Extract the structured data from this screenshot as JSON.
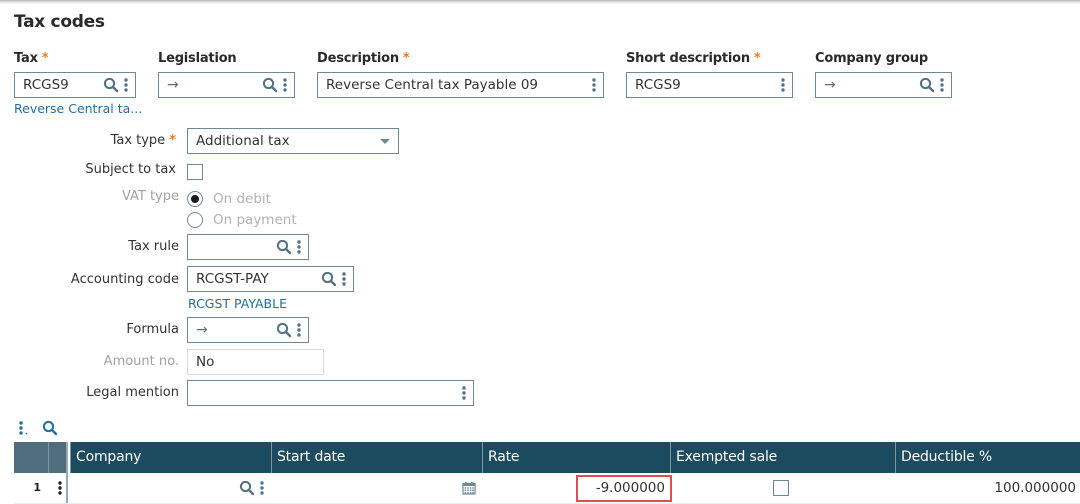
{
  "page": {
    "title": "Tax codes"
  },
  "header_fields": {
    "tax": {
      "label": "Tax",
      "required": true,
      "value": "RCGS9",
      "link": "Reverse Central ta..."
    },
    "legislation": {
      "label": "Legislation",
      "value": "→"
    },
    "description": {
      "label": "Description",
      "required": true,
      "value": "Reverse Central tax Payable 09"
    },
    "short_description": {
      "label": "Short description",
      "required": true,
      "value": "RCGS9"
    },
    "company_group": {
      "label": "Company group",
      "value": "→"
    }
  },
  "required_marker": "*",
  "form": {
    "tax_type": {
      "label": "Tax type",
      "required": true,
      "value": "Additional tax"
    },
    "subject_to_tax": {
      "label": "Subject to tax",
      "checked": false
    },
    "vat_type": {
      "label": "VAT type",
      "options": [
        {
          "label": "On debit",
          "selected": true
        },
        {
          "label": "On payment",
          "selected": false
        }
      ]
    },
    "tax_rule": {
      "label": "Tax rule",
      "value": ""
    },
    "accounting_code": {
      "label": "Accounting code",
      "value": "RCGST-PAY",
      "link": "RCGST PAYABLE"
    },
    "formula": {
      "label": "Formula",
      "value": "→"
    },
    "amount_no": {
      "label": "Amount no.",
      "value": "No"
    },
    "legal_mention": {
      "label": "Legal mention",
      "value": ""
    }
  },
  "grid": {
    "columns": [
      "Company",
      "Start date",
      "Rate",
      "Exempted sale",
      "Deductible %"
    ],
    "rows": [
      {
        "num": "1",
        "company": "",
        "start_date": "",
        "rate": "-9.000000",
        "exempted_sale": false,
        "deductible": "100.000000"
      }
    ]
  },
  "colors": {
    "accent_link": "#1d6fa5",
    "required": "#f07a21",
    "grid_header": "#1c4a5e",
    "highlight_border": "#d9504f"
  }
}
